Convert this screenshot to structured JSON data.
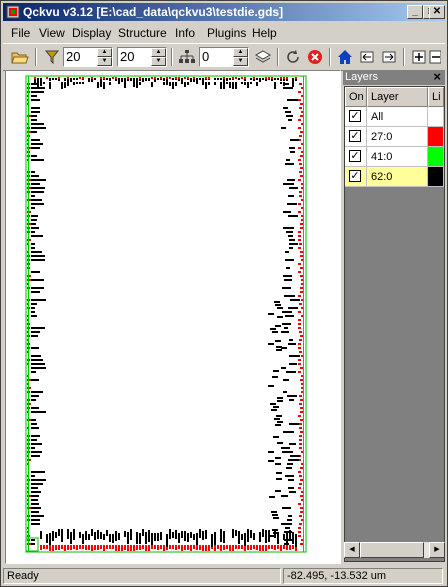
{
  "window": {
    "title": "Qckvu v3.12 [E:\\cad_data\\qckvu3\\testdie.gds]"
  },
  "menu": [
    "File",
    "View",
    "Display",
    "Structure",
    "Info",
    "Plugins",
    "Help"
  ],
  "toolbar": {
    "spin1": "20",
    "spin2": "20",
    "spin3": "0"
  },
  "layers_panel": {
    "title": "Layers",
    "columns": [
      "On",
      "Layer",
      "Li"
    ],
    "rows": [
      {
        "name": "All",
        "on": true,
        "color": "#ffffff",
        "selected": false
      },
      {
        "name": "27:0",
        "on": true,
        "color": "#ff0000",
        "selected": false
      },
      {
        "name": "41:0",
        "on": true,
        "color": "#00ff00",
        "selected": false
      },
      {
        "name": "62:0",
        "on": true,
        "color": "#000000",
        "selected": true
      }
    ]
  },
  "status": {
    "left": "Ready",
    "coords": "-82.495, -13.532 um"
  },
  "colors": {
    "layer_27": "#ff0000",
    "layer_41": "#00cc00",
    "layer_62": "#000000",
    "selected_row": "#ffff99"
  }
}
